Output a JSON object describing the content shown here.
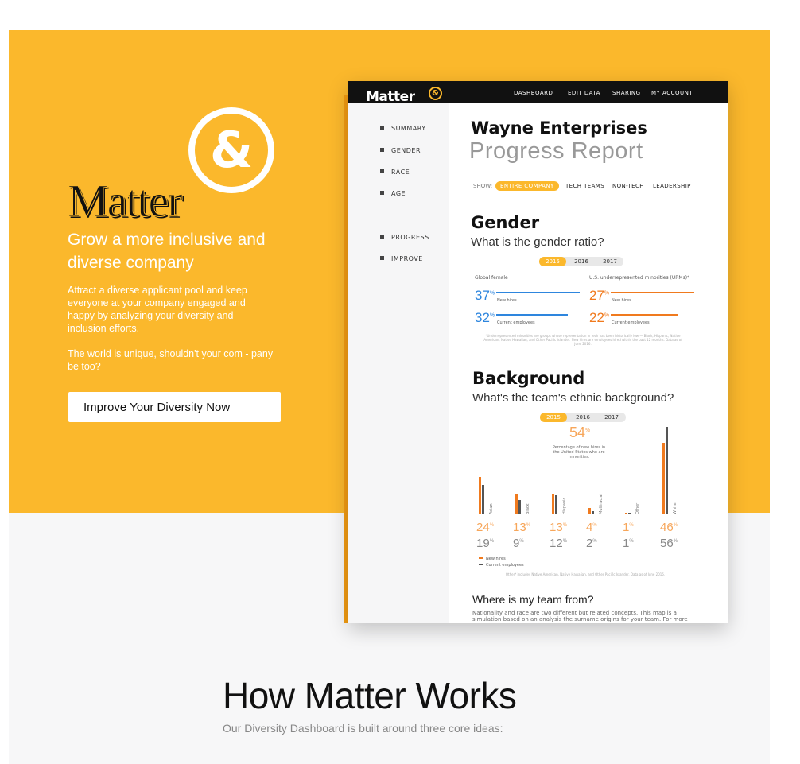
{
  "colors": {
    "accent": "#fbb82c",
    "orange": "#f07a1e",
    "blue": "#2e86de",
    "dark": "#111111"
  },
  "hero": {
    "brand_name": "Matter",
    "brand_symbol": "&",
    "tagline": "Grow a more inclusive and diverse company",
    "description": "Attract a diverse applicant pool and keep everyone at your company engaged and happy by analyzing your diversity and inclusion efforts.",
    "description2": "The world is unique, shouldn't your com       - pany be too?",
    "cta_label": "Improve Your Diversity Now"
  },
  "mockup": {
    "logo": "Matter",
    "logo_symbol": "&",
    "nav": [
      "DASHBOARD",
      "EDIT DATA",
      "SHARING",
      "MY ACCOUNT"
    ],
    "sidebar": [
      "SUMMARY",
      "GENDER",
      "RACE",
      "AGE",
      "PROGRESS",
      "IMPROVE"
    ],
    "company": "Wayne Enterprises",
    "report_title": "Progress Report",
    "show_label": "SHOW:",
    "filters": [
      "ENTIRE COMPANY",
      "TECH TEAMS",
      "NON-TECH",
      "LEADERSHIP"
    ],
    "gender": {
      "heading": "Gender",
      "question": "What is the gender ratio?",
      "years": [
        "2015",
        "2016",
        "2017"
      ],
      "left_label": "Global female",
      "right_label": "U.S. underrepresented minorities (URMs)*",
      "left": [
        {
          "value": "37",
          "unit": "%",
          "sub": "New hires"
        },
        {
          "value": "32",
          "unit": "%",
          "sub": "Current employees"
        }
      ],
      "right": [
        {
          "value": "27",
          "unit": "%",
          "sub": "New hires"
        },
        {
          "value": "22",
          "unit": "%",
          "sub": "Current employees"
        }
      ],
      "footnote": "*Underrepresented minorities are groups whose representation in tech has been historically low — Black, Hispanic, Native American, Native Hawaiian, and Other Pacific Islander. New hires are employees hired within the past 12 months. Data as of June 2016."
    },
    "background": {
      "heading": "Background",
      "question": "What's the team's ethnic background?",
      "years": [
        "2015",
        "2016",
        "2017"
      ],
      "headline_value": "54",
      "headline_unit": "%",
      "headline_caption": "Percentage of new hires in the United States who are minorities.",
      "legend": [
        "New hires",
        "Current employees"
      ],
      "footnote": "Other* includes Native American, Native Hawaiian, and Other Pacific Islander. Data as of June 2016."
    },
    "where": {
      "heading": "Where is my team from?",
      "text": "Nationality and race are two different but related concepts. This map is a simulation based on an analysis the surname origins for your team. For more accurate"
    }
  },
  "chart_data": {
    "type": "bar",
    "categories": [
      "Asian",
      "Black",
      "Hispanic",
      "Multiracial",
      "Other",
      "White"
    ],
    "series": [
      {
        "name": "New hires",
        "values": [
          24,
          13,
          13,
          4,
          1,
          46
        ]
      },
      {
        "name": "Current employees",
        "values": [
          19,
          9,
          12,
          2,
          1,
          56
        ]
      }
    ],
    "unit": "%"
  },
  "lower": {
    "title": "How Matter Works",
    "subtitle": "Our Diversity Dashboard is built around three core ideas:"
  }
}
